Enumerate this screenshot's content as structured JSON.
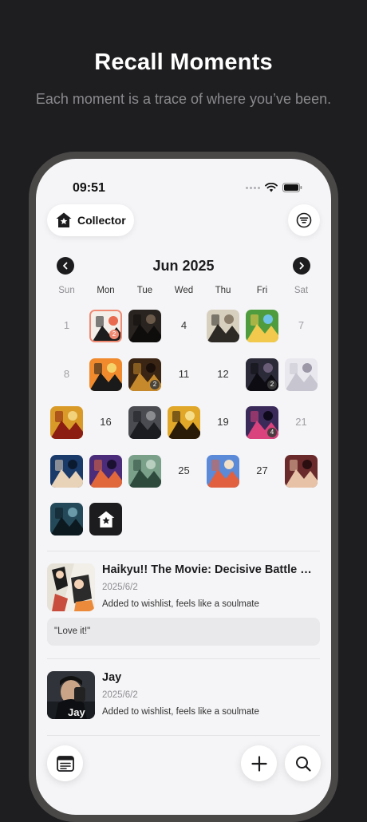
{
  "hero": {
    "title": "Recall Moments",
    "subtitle": "Each moment is a trace of where you’ve been."
  },
  "status_bar": {
    "time": "09:51",
    "icons": [
      "signal-dots-icon",
      "wifi-icon",
      "battery-icon"
    ]
  },
  "header": {
    "collector_label": "Collector",
    "collector_icon": "star-house-icon",
    "filter_icon": "filter-lines-icon"
  },
  "calendar": {
    "month_label": "Jun 2025",
    "prev_icon": "chevron-left-icon",
    "next_icon": "chevron-right-icon",
    "weekdays": [
      "Sun",
      "Mon",
      "Tue",
      "Wed",
      "Thu",
      "Fri",
      "Sat"
    ],
    "days": [
      {
        "day": 1,
        "num": "1",
        "weekend": true
      },
      {
        "day": 2,
        "thumb": "haikyu-art",
        "badge": "2",
        "selected": true
      },
      {
        "day": 3,
        "thumb": "dark-knight-art"
      },
      {
        "day": 4,
        "num": "4"
      },
      {
        "day": 5,
        "thumb": "tree-art"
      },
      {
        "day": 6,
        "thumb": "stardew-valley-art"
      },
      {
        "day": 7,
        "num": "7",
        "weekend": true
      },
      {
        "day": 8,
        "num": "8",
        "weekend": true
      },
      {
        "day": 9,
        "thumb": "group-poster-art"
      },
      {
        "day": 10,
        "thumb": "samurai-art",
        "badge": "2"
      },
      {
        "day": 11,
        "num": "11"
      },
      {
        "day": 12,
        "num": "12"
      },
      {
        "day": 13,
        "thumb": "dark-figure-art",
        "badge": "2"
      },
      {
        "day": 14,
        "thumb": "white-hair-anime-art"
      },
      {
        "day": 15,
        "thumb": "red-orb-art"
      },
      {
        "day": 16,
        "num": "16"
      },
      {
        "day": 17,
        "thumb": "throne-art"
      },
      {
        "day": 18,
        "thumb": "golden-eclipse-art"
      },
      {
        "day": 19,
        "num": "19"
      },
      {
        "day": 20,
        "thumb": "neon-city-art",
        "badge": "4"
      },
      {
        "day": 21,
        "num": "21",
        "weekend": true
      },
      {
        "day": 22,
        "thumb": "blue-face-art"
      },
      {
        "day": 23,
        "thumb": "avengers-art"
      },
      {
        "day": 24,
        "thumb": "misty-forest-art"
      },
      {
        "day": 25,
        "num": "25"
      },
      {
        "day": 26,
        "thumb": "detective-anime-art"
      },
      {
        "day": 27,
        "num": "27"
      },
      {
        "day": 28,
        "thumb": "portrait-art"
      },
      {
        "day": 29,
        "thumb": "dark-city-art"
      },
      {
        "day": 30,
        "logo": true
      }
    ]
  },
  "entries": [
    {
      "title": "Haikyu!! The Movie: Decisive Battle at...",
      "date": "2025/6/2",
      "note": "Added to wishlist, feels like a soulmate",
      "quote": "\"Love it!\"",
      "thumb": "haikyu-art"
    },
    {
      "title": "Jay",
      "date": "2025/6/2",
      "note": "Added to wishlist, feels like a soulmate",
      "thumb": "jay-album-art",
      "thumb_caption": "Jay"
    }
  ],
  "bottom_bar": {
    "left_icon": "list-card-icon",
    "add_icon": "plus-icon",
    "search_icon": "search-icon"
  },
  "colors": {
    "background": "#1e1e20",
    "screen": "#f5f5f7",
    "accent": "#f08a73",
    "dark": "#1c1c1e"
  }
}
